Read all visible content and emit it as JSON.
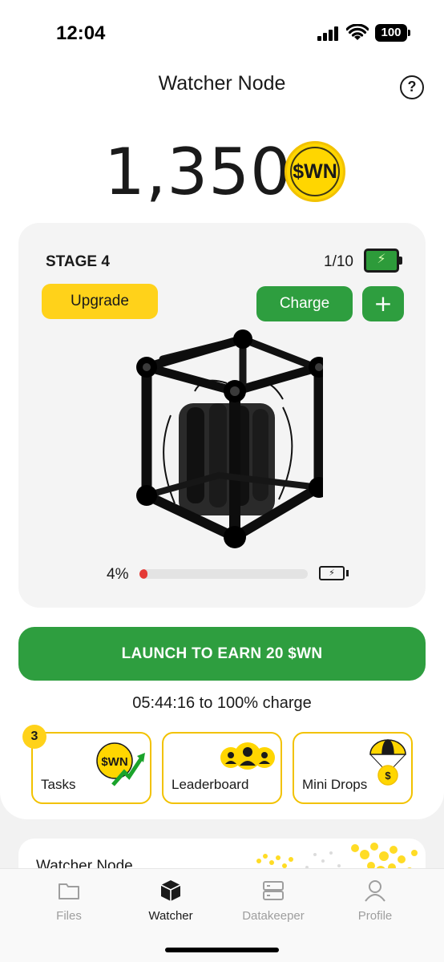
{
  "status_bar": {
    "time": "12:04",
    "battery": "100",
    "icons": [
      "signal-icon",
      "wifi-icon",
      "battery-icon"
    ]
  },
  "header": {
    "title": "Watcher Node",
    "help_icon": "?"
  },
  "balance": {
    "amount": "1,350",
    "currency": "$WN"
  },
  "stage_card": {
    "stage": "STAGE 4",
    "charges": "1/10",
    "upgrade_label": "Upgrade",
    "charge_label": "Charge",
    "plus_label": "+",
    "progress_text": "4%",
    "progress_fraction": 0.04
  },
  "launch": {
    "label": "LAUNCH TO EARN 20 $WN"
  },
  "countdown": "05:44:16 to 100% charge",
  "tiles": [
    {
      "label": "Tasks",
      "icon": "coin-trend-icon",
      "badge": "3",
      "icon_text": "$WN"
    },
    {
      "label": "Leaderboard",
      "icon": "users-icon"
    },
    {
      "label": "Mini Drops",
      "icon": "parachute-coin-icon",
      "icon_text": "$"
    }
  ],
  "next_card": {
    "title": "Watcher Node"
  },
  "tab_bar": {
    "items": [
      {
        "label": "Files",
        "icon": "folder-icon",
        "active": false
      },
      {
        "label": "Watcher",
        "icon": "cube-icon",
        "active": true
      },
      {
        "label": "Datakeeper",
        "icon": "server-icon",
        "active": false
      },
      {
        "label": "Profile",
        "icon": "person-icon",
        "active": false
      }
    ]
  },
  "colors": {
    "accent_green": "#2e9e3f",
    "accent_yellow": "#ffd21a",
    "progress_red": "#e53935"
  }
}
